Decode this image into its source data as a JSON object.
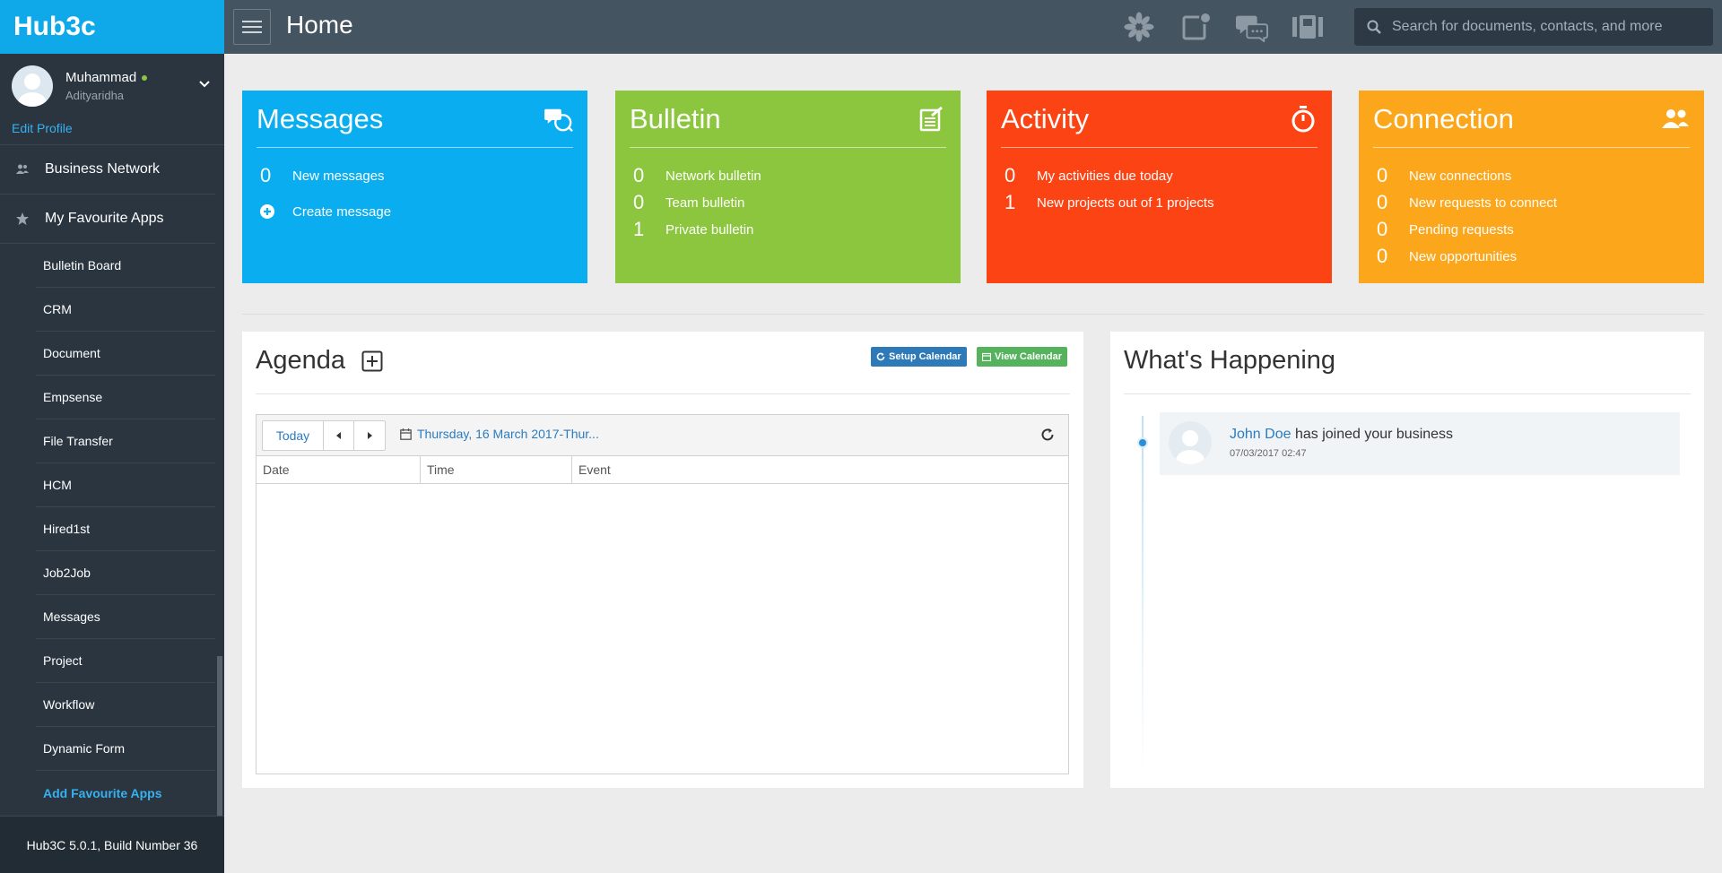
{
  "brand": "Hub3c",
  "profile": {
    "name": "Muhammad",
    "subtitle": "Adityaridha",
    "edit_label": "Edit Profile"
  },
  "nav": {
    "business_network": "Business Network",
    "favourites": "My Favourite Apps",
    "apps": [
      "Bulletin Board",
      "CRM",
      "Document",
      "Empsense",
      "File Transfer",
      "HCM",
      "Hired1st",
      "Job2Job",
      "Messages",
      "Project",
      "Workflow",
      "Dynamic Form"
    ],
    "add_apps": "Add Favourite Apps"
  },
  "version": "Hub3C 5.0.1, Build Number 36",
  "topbar": {
    "title": "Home",
    "search_placeholder": "Search for documents, contacts, and more"
  },
  "tiles": {
    "messages": {
      "title": "Messages",
      "rows": [
        {
          "num": "0",
          "text": "New messages"
        }
      ],
      "create": "Create message"
    },
    "bulletin": {
      "title": "Bulletin",
      "rows": [
        {
          "num": "0",
          "text": "Network bulletin"
        },
        {
          "num": "0",
          "text": "Team bulletin"
        },
        {
          "num": "1",
          "text": "Private bulletin"
        }
      ]
    },
    "activity": {
      "title": "Activity",
      "rows": [
        {
          "num": "0",
          "text": "My activities due today"
        },
        {
          "num": "1",
          "text": "New projects out of 1 projects"
        }
      ]
    },
    "connection": {
      "title": "Connection",
      "rows": [
        {
          "num": "0",
          "text": "New connections"
        },
        {
          "num": "0",
          "text": "New requests to connect"
        },
        {
          "num": "0",
          "text": "Pending requests"
        },
        {
          "num": "0",
          "text": "New opportunities"
        }
      ]
    }
  },
  "agenda": {
    "title": "Agenda",
    "setup_calendar": "Setup Calendar",
    "view_calendar": "View Calendar",
    "today": "Today",
    "range": "Thursday, 16 March 2017-Thur...",
    "columns": [
      "Date",
      "Time",
      "Event"
    ]
  },
  "happening": {
    "title": "What's Happening",
    "event": {
      "user": "John Doe",
      "text": " has joined your business",
      "time": "07/03/2017 02:47"
    }
  },
  "colors": {
    "messages": "#0aaef0",
    "bulletin": "#8cc63f",
    "activity": "#fc4314",
    "connection": "#fba61b"
  }
}
